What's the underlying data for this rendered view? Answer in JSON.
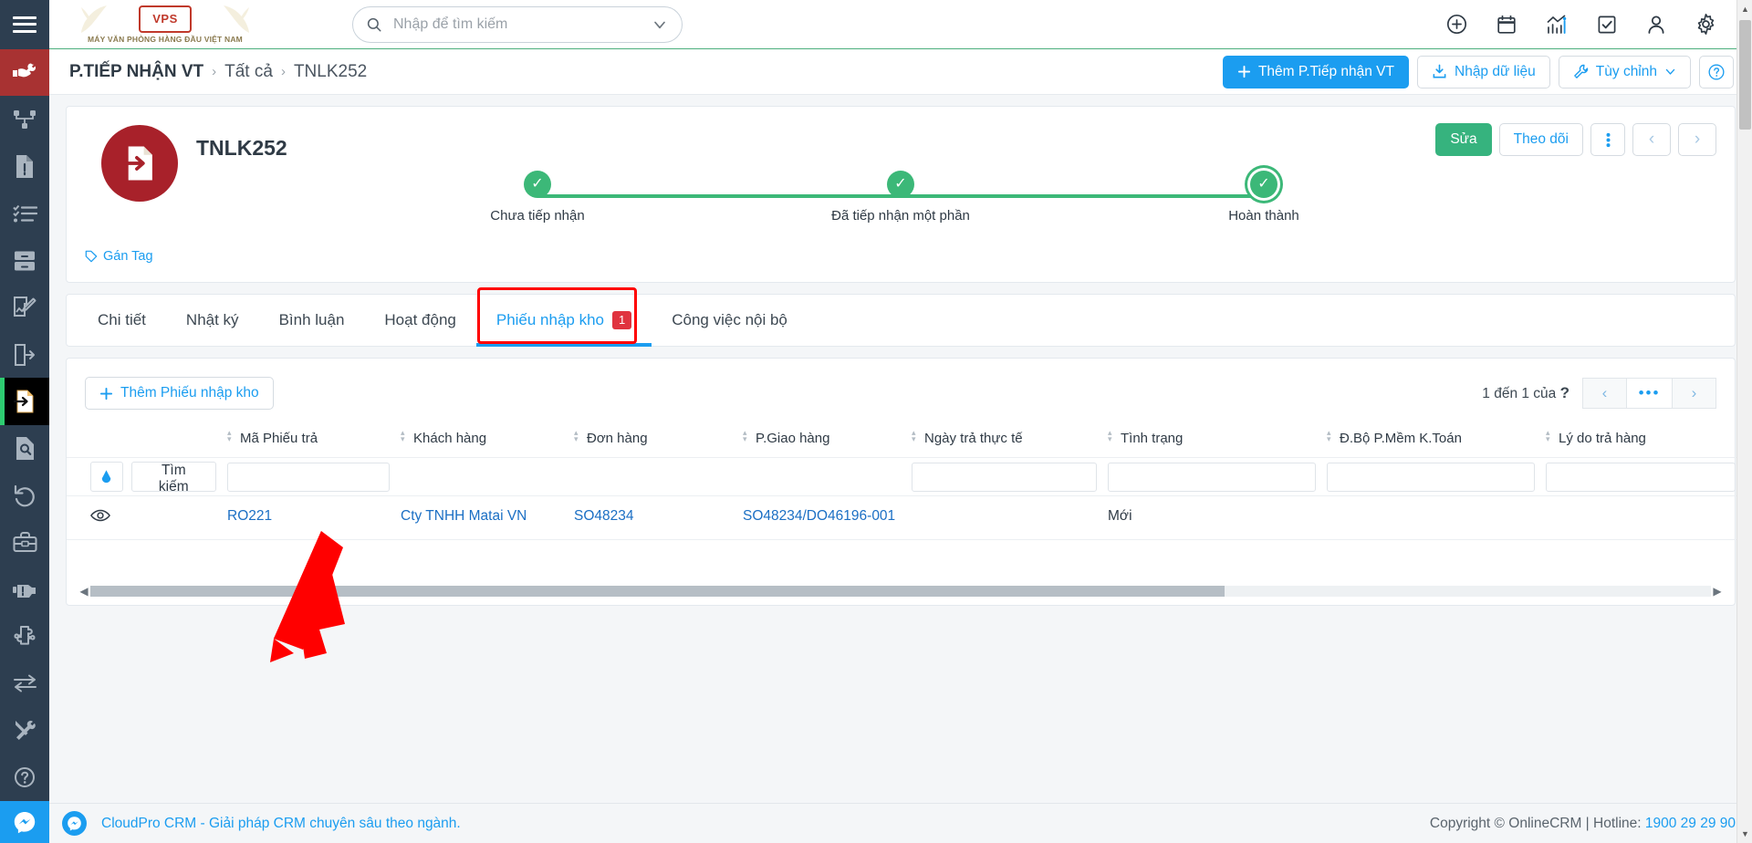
{
  "topbar": {
    "logo_text": "VPS",
    "logo_tagline": "MÁY VĂN PHÒNG HÀNG ĐẦU VIỆT NAM",
    "search_placeholder": "Nhập để tìm kiếm",
    "search_value": "",
    "icons": [
      "add-circle-icon",
      "calendar-icon",
      "chart-icon",
      "task-check-icon",
      "user-icon",
      "gear-icon"
    ]
  },
  "rail": {
    "items": [
      {
        "name": "service-hand-icon",
        "state": "active-red"
      },
      {
        "name": "sitemap-icon",
        "state": "normal"
      },
      {
        "name": "document-alert-icon",
        "state": "normal"
      },
      {
        "name": "checklist-icon",
        "state": "normal"
      },
      {
        "name": "file-cabinet-icon",
        "state": "normal"
      },
      {
        "name": "document-edit-icon",
        "state": "normal"
      },
      {
        "name": "document-export-icon",
        "state": "normal"
      },
      {
        "name": "document-import-icon",
        "state": "active-black"
      },
      {
        "name": "document-search-icon",
        "state": "normal"
      },
      {
        "name": "undo-icon",
        "state": "normal"
      },
      {
        "name": "toolbox-icon",
        "state": "normal"
      },
      {
        "name": "engine-alert-icon",
        "state": "normal"
      },
      {
        "name": "puzzle-icon",
        "state": "normal"
      },
      {
        "name": "transfer-icon",
        "state": "normal"
      },
      {
        "name": "tools-icon",
        "state": "normal"
      },
      {
        "name": "help-circle-icon",
        "state": "normal"
      }
    ]
  },
  "breadcrumb": {
    "module": "P.TIẾP NHẬN VT",
    "sep": "›",
    "all": "Tất cả",
    "record": "TNLK252"
  },
  "crumb_actions": {
    "add_label": "Thêm P.Tiếp nhận VT",
    "import_label": "Nhập dữ liệu",
    "customize_label": "Tùy chỉnh",
    "help_label": "?"
  },
  "record": {
    "title": "TNLK252",
    "edit_label": "Sửa",
    "follow_label": "Theo dõi",
    "more_label": "⋮",
    "prev_label": "‹",
    "next_label": "›",
    "tag_label": "Gán Tag"
  },
  "stages": [
    {
      "label": "Chưa tiếp nhận",
      "done": true,
      "current": false
    },
    {
      "label": "Đã tiếp nhận một phần",
      "done": true,
      "current": false
    },
    {
      "label": "Hoàn thành",
      "done": true,
      "current": true
    }
  ],
  "tabs": [
    {
      "label": "Chi tiết",
      "active": false,
      "badge": ""
    },
    {
      "label": "Nhật ký",
      "active": false,
      "badge": ""
    },
    {
      "label": "Bình luận",
      "active": false,
      "badge": ""
    },
    {
      "label": "Hoạt động",
      "active": false,
      "badge": ""
    },
    {
      "label": "Phiếu nhập kho",
      "active": true,
      "badge": "1"
    },
    {
      "label": "Công việc nội bộ",
      "active": false,
      "badge": ""
    }
  ],
  "grid": {
    "add_label": "Thêm Phiếu nhập kho",
    "pager_text": "1 đến 1 của",
    "pager_total": "?",
    "pager_prev": "‹",
    "pager_mid": "•••",
    "pager_next": "›",
    "search_label": "Tìm kiếm",
    "columns": [
      "Mã Phiếu trả",
      "Khách hàng",
      "Đơn hàng",
      "P.Giao hàng",
      "Ngày trả thực tế",
      "Tình trạng",
      "Đ.Bộ P.Mềm K.Toán",
      "Lý do trả hàng"
    ],
    "filters": [
      "",
      "",
      "",
      "",
      "",
      "",
      "",
      ""
    ],
    "rows": [
      {
        "ma_phieu_tra": "RO221",
        "khach_hang": "Cty TNHH Matai VN",
        "don_hang": "SO48234",
        "p_giao_hang": "SO48234/DO46196-001",
        "ngay_tra_thuc_te": "",
        "tinh_trang": "Mới",
        "dbo_pmem_ktoan": "",
        "ly_do_tra_hang": ""
      }
    ]
  },
  "footer": {
    "left_text": "CloudPro CRM - Giải pháp CRM chuyên sâu theo ngành.",
    "copyright": "Copyright © OnlineCRM | Hotline: ",
    "hotline": "1900 29 29 90"
  },
  "colors": {
    "accent_blue": "#1b9df0",
    "green": "#3cb878",
    "rail_dark": "#2d3e50",
    "active_red": "#a83232",
    "badge_red": "#e0333f",
    "annotation_red": "#ff0000"
  }
}
